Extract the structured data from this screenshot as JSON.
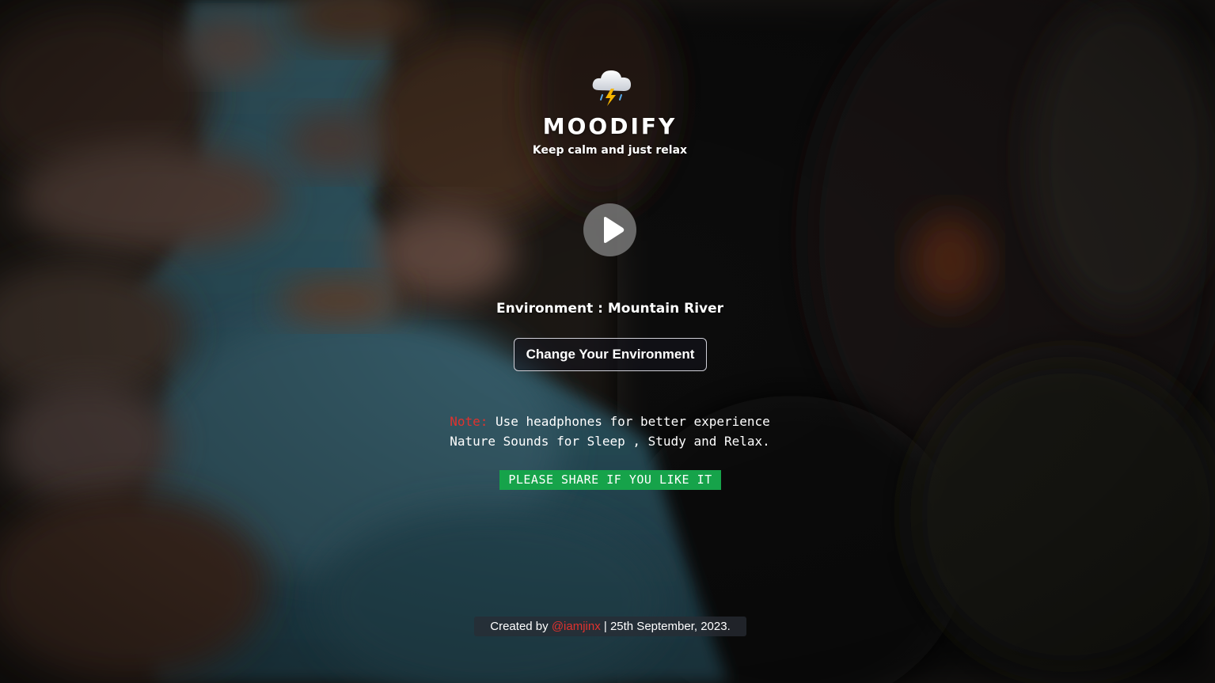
{
  "app": {
    "title": "MOODIFY",
    "tagline": "Keep calm and just relax",
    "logo_icon": "cloud-lightning-icon"
  },
  "player": {
    "play_icon": "play-icon",
    "environment_prefix": "Environment : ",
    "environment_name": "Mountain River",
    "change_button_label": "Change Your Environment"
  },
  "note": {
    "tag": "Note:",
    "line1": " Use headphones for better experience",
    "line2": "Nature Sounds for Sleep , Study and Relax."
  },
  "share": {
    "label": "PLEASE SHARE IF YOU LIKE IT"
  },
  "footer": {
    "prefix": "Created by ",
    "handle": "@iamjinx",
    "suffix": " | 25th September, 2023."
  },
  "colors": {
    "accent_red": "#e0322e",
    "share_green": "#16a34a",
    "text": "#ffffff"
  }
}
